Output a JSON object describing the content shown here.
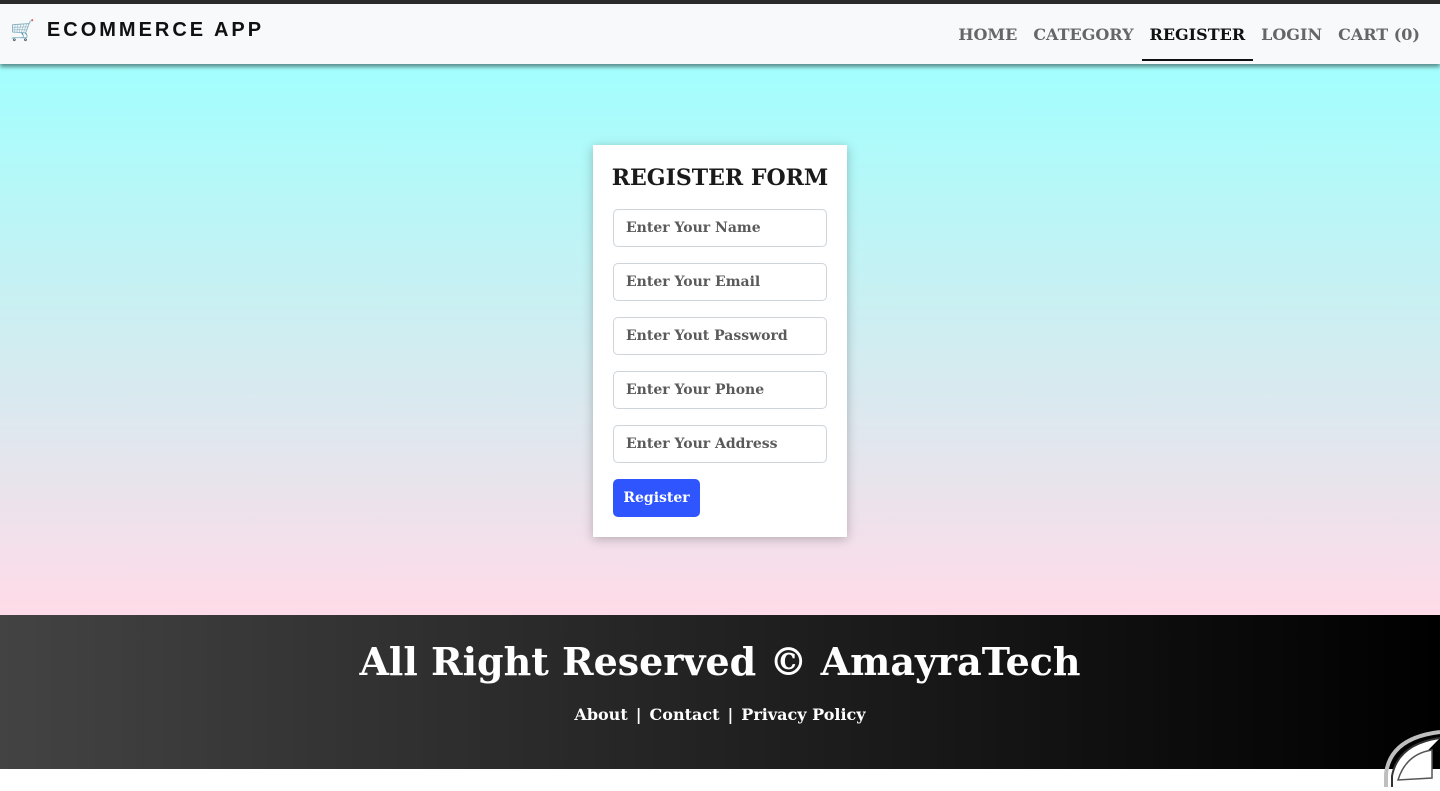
{
  "navbar": {
    "brand_icon": "🛒",
    "brand_label": "ECOMMERCE APP",
    "links": [
      {
        "label": "HOME"
      },
      {
        "label": "CATEGORY"
      },
      {
        "label": "REGISTER"
      },
      {
        "label": "LOGIN"
      },
      {
        "label": "CART (0)"
      }
    ]
  },
  "form": {
    "title": "REGISTER FORM",
    "name_placeholder": "Enter Your Name",
    "email_placeholder": "Enter Your Email",
    "password_placeholder": "Enter Yout Password",
    "phone_placeholder": "Enter Your Phone",
    "address_placeholder": "Enter Your Address",
    "submit_label": "Register"
  },
  "footer": {
    "copyright": "All Right Reserved © AmayraTech",
    "links": [
      {
        "label": "About"
      },
      {
        "label": "Contact"
      },
      {
        "label": "Privacy Policy"
      }
    ],
    "separator": "|"
  },
  "colors": {
    "accent_button": "#2f55ff",
    "gradient_top": "#a2fffe",
    "gradient_bottom": "#ffdbe8"
  }
}
